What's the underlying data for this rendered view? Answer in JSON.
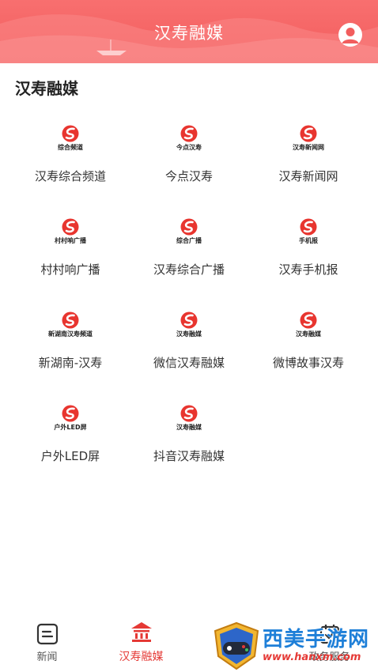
{
  "header": {
    "title": "汉寿融媒",
    "user_icon": "user-avatar-icon",
    "background_color": "#f46363"
  },
  "section": {
    "title": "汉寿融媒"
  },
  "brand_color": "#e8352f",
  "channels": [
    {
      "brand": "综合频道",
      "label": "汉寿综合频道"
    },
    {
      "brand": "今点汉寿",
      "label": "今点汉寿"
    },
    {
      "brand": "汉寿新闻网",
      "label": "汉寿新闻网"
    },
    {
      "brand": "村村响广播",
      "label": "村村响广播"
    },
    {
      "brand": "综合广播",
      "label": "汉寿综合广播"
    },
    {
      "brand": "手机报",
      "label": "汉寿手机报"
    },
    {
      "brand": "新湖南汉寿频道",
      "label": "新湖南-汉寿"
    },
    {
      "brand": "汉寿融媒",
      "label": "微信汉寿融媒"
    },
    {
      "brand": "汉寿融媒",
      "label": "微博故事汉寿"
    },
    {
      "brand": "户外LED屏",
      "label": "户外LED屏"
    },
    {
      "brand": "汉寿融媒",
      "label": "抖音汉寿融媒"
    }
  ],
  "tabbar": {
    "active_color": "#e53935",
    "tabs": [
      {
        "label": "新闻",
        "icon": "news-icon"
      },
      {
        "label": "汉寿融媒",
        "icon": "media-building-icon"
      },
      {
        "label": "",
        "icon": "calendar-icon"
      },
      {
        "label": "政务服务",
        "icon": "government-service-icon"
      }
    ]
  },
  "watermark": {
    "text": "西美手游网",
    "url": "www.hanxm.com"
  }
}
